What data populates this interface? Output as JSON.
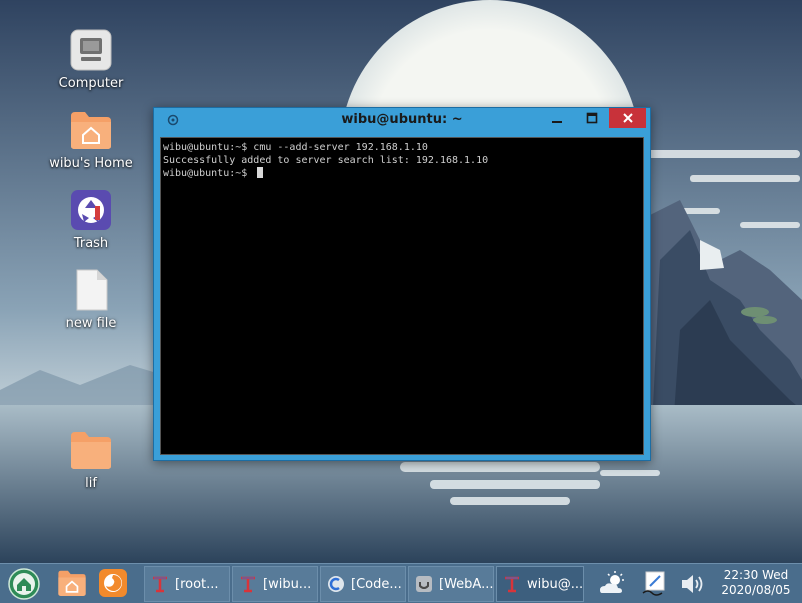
{
  "desktop": {
    "icons": [
      {
        "label": "Computer",
        "icon": "computer-icon"
      },
      {
        "label": "wibu's Home",
        "icon": "home-folder-icon"
      },
      {
        "label": "Trash",
        "icon": "trash-icon"
      },
      {
        "label": "new file",
        "icon": "file-icon"
      },
      {
        "label": "lif",
        "icon": "folder-icon"
      }
    ]
  },
  "terminal": {
    "title": "wibu@ubuntu: ~",
    "lines": [
      "wibu@ubuntu:~$ cmu --add-server 192.168.1.10",
      "Successfully added to server search list: 192.168.1.10",
      "wibu@ubuntu:~$ "
    ]
  },
  "taskbar": {
    "tasks": [
      {
        "label": "[root...",
        "icon": "terminal-icon"
      },
      {
        "label": "[wibu...",
        "icon": "terminal-icon"
      },
      {
        "label": "[Code...",
        "icon": "codeblocks-icon"
      },
      {
        "label": "[WebA...",
        "icon": "webapp-icon"
      },
      {
        "label": "wibu@...",
        "icon": "terminal-icon"
      }
    ],
    "clock": {
      "time": "22:30 Wed",
      "date": "2020/08/05"
    }
  },
  "colors": {
    "titlebar": "#3a9fd8",
    "close_button": "#c8323a",
    "taskbar": "#4a6d8c",
    "terminal_bg": "#000000",
    "folder": "#f5a067"
  }
}
